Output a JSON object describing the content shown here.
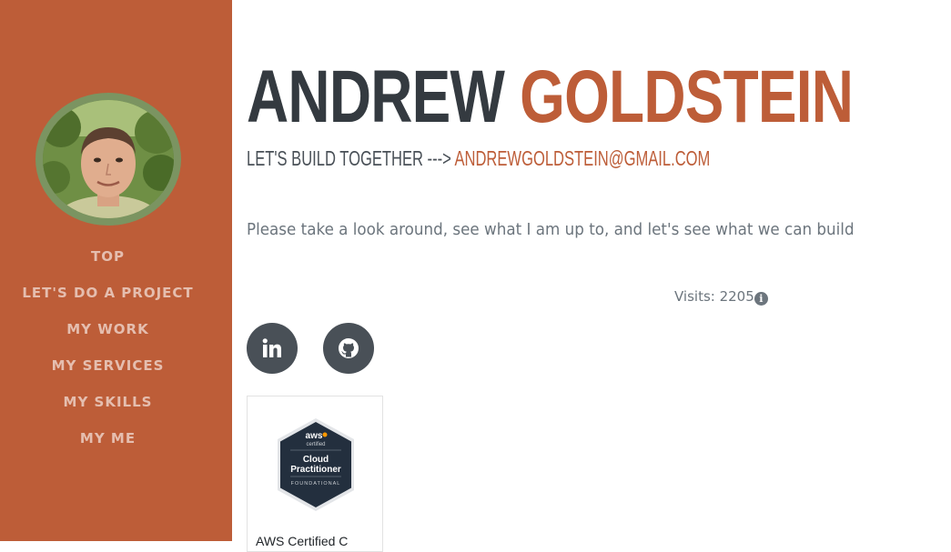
{
  "profile": {
    "first_name": "ANDREW",
    "last_name": "GOLDSTEIN",
    "tagline": "LET'S BUILD TOGETHER --->",
    "email": "ANDREWGOLDSTEIN@GMAIL.COM",
    "lead": "Please take a look around, see what I am up to, and let's see what we can build"
  },
  "nav": {
    "items": [
      {
        "label": "TOP"
      },
      {
        "label": "LET'S DO A PROJECT"
      },
      {
        "label": "MY WORK"
      },
      {
        "label": "MY SERVICES"
      },
      {
        "label": "MY SKILLS"
      },
      {
        "label": "MY ME"
      }
    ]
  },
  "visits": {
    "label": "Visits: 2205"
  },
  "social": {
    "linkedin_icon": "linkedin-icon",
    "github_icon": "github-icon"
  },
  "badge": {
    "brand": "aws",
    "certified": "certified",
    "line1": "Cloud",
    "line2": "Practitioner",
    "level": "FOUNDATIONAL",
    "caption": "AWS Certified C"
  },
  "colors": {
    "primary": "#bd5d38",
    "dark": "#343a40",
    "social_bg": "#495057",
    "text_muted": "#6c757d"
  }
}
